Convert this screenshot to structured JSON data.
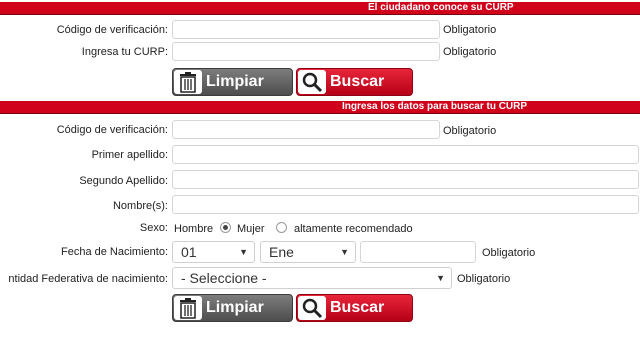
{
  "section1": {
    "title": "El ciudadano conoce su CURP",
    "verification_label": "Código de verificación:",
    "verification_value": "",
    "verification_required": "Obligatorio",
    "curp_label": "Ingresa tu CURP:",
    "curp_value": "",
    "curp_required": "Obligatorio",
    "clear_label": "Limpiar",
    "search_label": "Buscar"
  },
  "section2": {
    "title": "Ingresa los datos para buscar tu CURP",
    "verification_label": "Código de verificación:",
    "verification_value": "",
    "verification_required": "Obligatorio",
    "first_surname_label": "Primer apellido:",
    "first_surname_value": "",
    "second_surname_label": "Segundo Apellido:",
    "second_surname_value": "",
    "names_label": "Nombre(s):",
    "names_value": "",
    "sex_label": "Sexo:",
    "sex_options": [
      "Hombre",
      "Mujer"
    ],
    "sex_selected": "Hombre",
    "sex_note": "altamente recomendado",
    "birthdate_label": "Fecha de Nacimiento:",
    "day_value": "01",
    "month_value": "Ene",
    "year_value": "",
    "birthdate_required": "Obligatorio",
    "state_label": "ntidad Federativa de nacimiento:",
    "state_value": "- Seleccione -",
    "state_required": "Obligatorio",
    "clear_label": "Limpiar",
    "search_label": "Buscar"
  },
  "colors": {
    "header_red": "#d0021b",
    "search_red": "#c8001a",
    "clear_gray": "#5e5e5e"
  }
}
